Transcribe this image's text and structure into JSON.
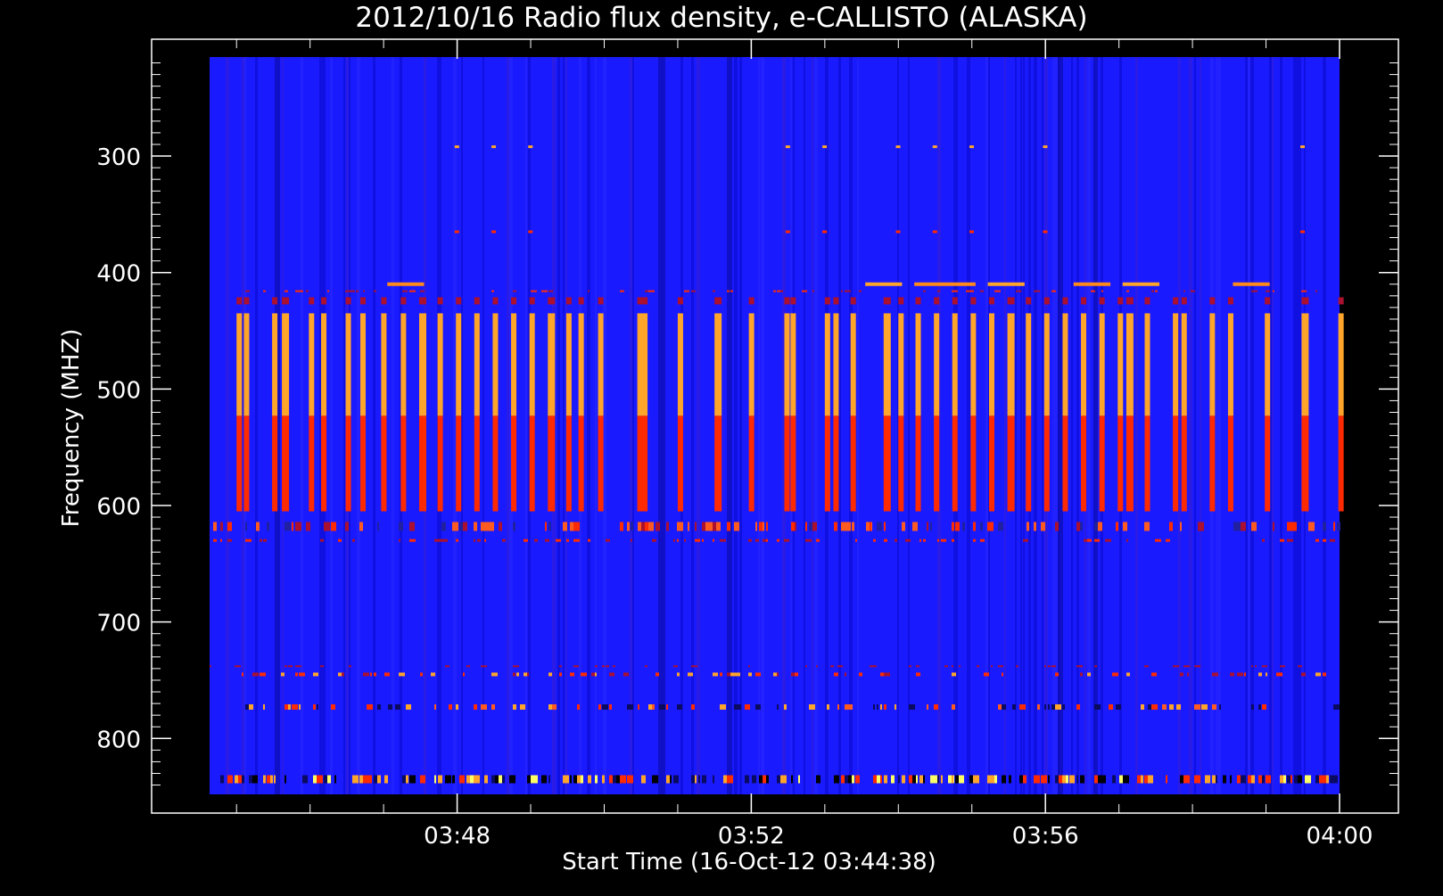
{
  "chart_data": {
    "type": "heatmap",
    "title": "2012/10/16  Radio flux density, e-CALLISTO (ALASKA)",
    "xlabel": "Start Time (16-Oct-12 03:44:38)",
    "ylabel": "Frequency (MHZ)",
    "x_range": [
      "03:44:38",
      "04:00:00"
    ],
    "y_range_mhz": [
      215,
      848
    ],
    "y_axis_inverted": true,
    "x_ticks": [
      "03:48",
      "03:52",
      "03:56",
      "04:00"
    ],
    "y_ticks": [
      300,
      400,
      500,
      600,
      700,
      800
    ],
    "colors": {
      "background": "#000000",
      "axis": "#ffffff",
      "low_flux": "#1a1aff",
      "medium_flux": "#ff2a00",
      "high_flux": "#ffa52a",
      "peak_flux": "#ffff66"
    },
    "bursts": {
      "freq_range_mhz": [
        435,
        605
      ],
      "split_mhz": 523,
      "times": [
        "03:45:00",
        "03:45:06",
        "03:45:29",
        "03:45:37",
        "03:45:59",
        "03:46:09",
        "03:46:29",
        "03:46:41",
        "03:46:58",
        "03:47:14",
        "03:47:29",
        "03:47:44",
        "03:47:59",
        "03:48:14",
        "03:48:29",
        "03:48:44",
        "03:48:59",
        "03:49:14",
        "03:49:29",
        "03:49:39",
        "03:49:55",
        "03:50:27",
        "03:50:31",
        "03:51:00",
        "03:51:30",
        "03:51:58",
        "03:52:27",
        "03:52:32",
        "03:53:00",
        "03:53:07",
        "03:53:21",
        "03:53:48",
        "03:54:00",
        "03:54:14",
        "03:54:29",
        "03:54:44",
        "03:54:59",
        "03:55:14",
        "03:55:29",
        "03:55:44",
        "03:55:59",
        "03:56:14",
        "03:56:29",
        "03:56:44",
        "03:56:59",
        "03:57:06",
        "03:57:21",
        "03:57:44",
        "03:57:51",
        "03:58:14",
        "03:58:29",
        "03:58:59",
        "03:59:29",
        "03:59:59"
      ]
    },
    "rfi_band_mhz": [
      612,
      630
    ]
  }
}
